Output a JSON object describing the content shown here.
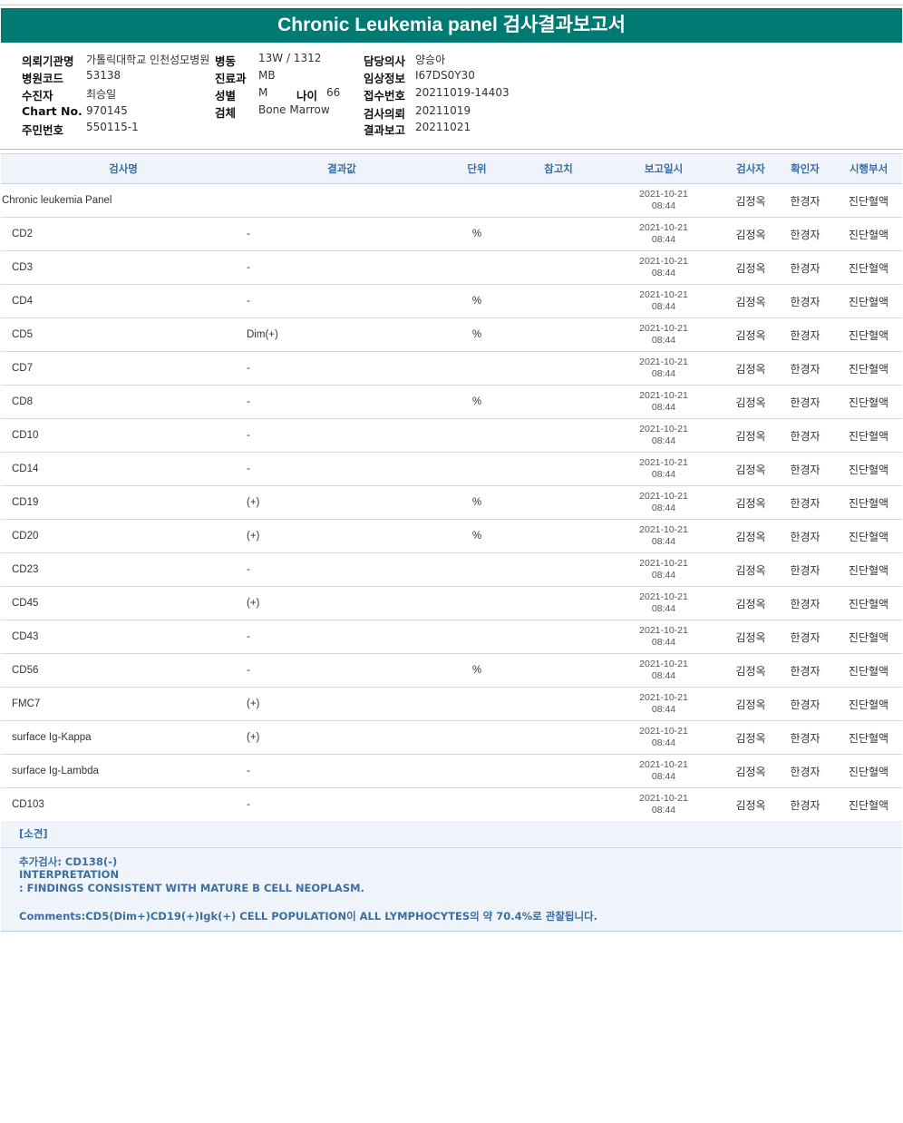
{
  "title": "Chronic Leukemia panel 검사결과보고서",
  "info": {
    "institution_label": "의뢰기관명",
    "institution_value": "가톨릭대학교 인천성모병원",
    "ward_label": "병동",
    "ward_value": "13W / 1312",
    "doctor_label": "담당의사",
    "doctor_value": "양승아",
    "hospital_code_label": "병원코드",
    "hospital_code_value": "53138",
    "dept_label": "진료과",
    "dept_value": "MB",
    "clinical_label": "임상정보",
    "clinical_value": "I67DS0Y30",
    "patient_label": "수진자",
    "patient_value": "최승일",
    "sex_label": "성별",
    "sex_value": "M",
    "age_label": "나이",
    "age_value": "66",
    "receipt_label": "접수번호",
    "receipt_value": "20211019-14403",
    "chart_label": "Chart No.",
    "chart_value": "970145",
    "specimen_label": "검체",
    "specimen_value": "Bone Marrow",
    "request_label": "검사의뢰",
    "request_value": "20211019",
    "id_label": "주민번호",
    "id_value": "550115-1",
    "report_label": "결과보고",
    "report_value": "20211021"
  },
  "table": {
    "headers": {
      "test": "검사명",
      "result": "결과값",
      "unit": "단위",
      "ref": "참고치",
      "date": "보고일시",
      "tester": "검사자",
      "confirmer": "확인자",
      "dept": "시행부서"
    },
    "rows": [
      {
        "name": "Chronic leukemia Panel",
        "result": "",
        "unit": "",
        "date": "2021-10-21",
        "time": "08:44",
        "tester": "김정옥",
        "confirmer": "한경자",
        "dept": "진단혈액"
      },
      {
        "name": "CD2",
        "result": "-",
        "unit": "%",
        "date": "2021-10-21",
        "time": "08:44",
        "tester": "김정옥",
        "confirmer": "한경자",
        "dept": "진단혈액"
      },
      {
        "name": "CD3",
        "result": "-",
        "unit": "",
        "date": "2021-10-21",
        "time": "08:44",
        "tester": "김정옥",
        "confirmer": "한경자",
        "dept": "진단혈액"
      },
      {
        "name": "CD4",
        "result": "-",
        "unit": "%",
        "date": "2021-10-21",
        "time": "08:44",
        "tester": "김정옥",
        "confirmer": "한경자",
        "dept": "진단혈액"
      },
      {
        "name": "CD5",
        "result": "Dim(+)",
        "unit": "%",
        "date": "2021-10-21",
        "time": "08:44",
        "tester": "김정옥",
        "confirmer": "한경자",
        "dept": "진단혈액"
      },
      {
        "name": "CD7",
        "result": "-",
        "unit": "",
        "date": "2021-10-21",
        "time": "08:44",
        "tester": "김정옥",
        "confirmer": "한경자",
        "dept": "진단혈액"
      },
      {
        "name": "CD8",
        "result": "-",
        "unit": "%",
        "date": "2021-10-21",
        "time": "08:44",
        "tester": "김정옥",
        "confirmer": "한경자",
        "dept": "진단혈액"
      },
      {
        "name": "CD10",
        "result": "-",
        "unit": "",
        "date": "2021-10-21",
        "time": "08:44",
        "tester": "김정옥",
        "confirmer": "한경자",
        "dept": "진단혈액"
      },
      {
        "name": "CD14",
        "result": "-",
        "unit": "",
        "date": "2021-10-21",
        "time": "08:44",
        "tester": "김정옥",
        "confirmer": "한경자",
        "dept": "진단혈액"
      },
      {
        "name": "CD19",
        "result": "(+)",
        "unit": "%",
        "date": "2021-10-21",
        "time": "08:44",
        "tester": "김정옥",
        "confirmer": "한경자",
        "dept": "진단혈액"
      },
      {
        "name": "CD20",
        "result": "(+)",
        "unit": "%",
        "date": "2021-10-21",
        "time": "08:44",
        "tester": "김정옥",
        "confirmer": "한경자",
        "dept": "진단혈액"
      },
      {
        "name": "CD23",
        "result": "-",
        "unit": "",
        "date": "2021-10-21",
        "time": "08:44",
        "tester": "김정옥",
        "confirmer": "한경자",
        "dept": "진단혈액"
      },
      {
        "name": "CD45",
        "result": "(+)",
        "unit": "",
        "date": "2021-10-21",
        "time": "08:44",
        "tester": "김정옥",
        "confirmer": "한경자",
        "dept": "진단혈액"
      },
      {
        "name": "CD43",
        "result": "-",
        "unit": "",
        "date": "2021-10-21",
        "time": "08:44",
        "tester": "김정옥",
        "confirmer": "한경자",
        "dept": "진단혈액"
      },
      {
        "name": "CD56",
        "result": "-",
        "unit": "%",
        "date": "2021-10-21",
        "time": "08:44",
        "tester": "김정옥",
        "confirmer": "한경자",
        "dept": "진단혈액"
      },
      {
        "name": "FMC7",
        "result": "(+)",
        "unit": "",
        "date": "2021-10-21",
        "time": "08:44",
        "tester": "김정옥",
        "confirmer": "한경자",
        "dept": "진단혈액"
      },
      {
        "name": "surface Ig-Kappa",
        "result": "(+)",
        "unit": "",
        "date": "2021-10-21",
        "time": "08:44",
        "tester": "김정옥",
        "confirmer": "한경자",
        "dept": "진단혈액"
      },
      {
        "name": "surface Ig-Lambda",
        "result": "-",
        "unit": "",
        "date": "2021-10-21",
        "time": "08:44",
        "tester": "김정옥",
        "confirmer": "한경자",
        "dept": "진단혈액"
      },
      {
        "name": "CD103",
        "result": "-",
        "unit": "",
        "date": "2021-10-21",
        "time": "08:44",
        "tester": "김정옥",
        "confirmer": "한경자",
        "dept": "진단혈액"
      }
    ]
  },
  "findings": {
    "header": "[소견]",
    "line1": "추가검사: CD138(-)",
    "line2": "INTERPRETATION",
    "line3": " : FINDINGS CONSISTENT WITH MATURE B CELL NEOPLASM.",
    "line4": "Comments:CD5(Dim+)CD19(+)Igk(+) CELL POPULATION이 ALL LYMPHOCYTES의 약 70.4%로 관찰됩니다."
  },
  "colors": {
    "title_bg": "#007a72",
    "header_bg": "#eef4fa",
    "header_text": "#3d6ea1"
  }
}
